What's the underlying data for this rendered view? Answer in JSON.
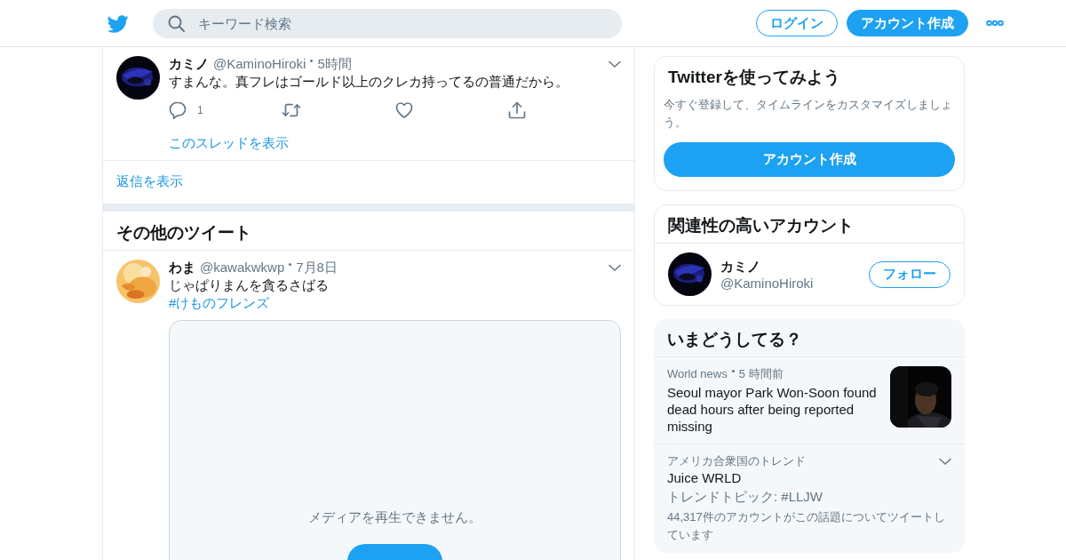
{
  "header": {
    "search": {
      "placeholder": "キーワード検索"
    },
    "login_button": "ログイン",
    "signup_button": "アカウント作成"
  },
  "thread": {
    "tweet": {
      "name": "カミノ",
      "handle": "@KaminoHiroki",
      "time": "5時間",
      "text": "すまんな。真フレはゴールド以上のクレカ持ってるの普通だから。",
      "reply_count": "1"
    },
    "show_thread": "このスレッドを表示",
    "show_replies": "返信を表示"
  },
  "more_tweets": {
    "title": "その他のツイート",
    "tweets": [
      {
        "name": "わま",
        "handle": "@kawakwkwp",
        "time": "7月8日",
        "text": "じゃぱりまんを貪るさばる",
        "hashtag": "#けものフレンズ",
        "media": {
          "message": "メディアを再生できません。"
        }
      }
    ]
  },
  "signup_card": {
    "title": "Twitterを使ってみよう",
    "text": "今すぐ登録して、タイムラインをカスタマイズしましょう。",
    "button": "アカウント作成"
  },
  "related": {
    "title": "関連性の高いアカウント",
    "accounts": [
      {
        "name": "カミノ",
        "handle": "@KaminoHiroki",
        "button": "フォロー"
      }
    ]
  },
  "trends": {
    "title": "いまどうしてる？",
    "items": [
      {
        "kind": "news",
        "meta": "World news",
        "time": "5 時間前",
        "headline": "Seoul mayor Park Won-Soon found dead hours after being reported missing"
      },
      {
        "kind": "trend",
        "meta": "アメリカ合衆国のトレンド",
        "name": "Juice WRLD",
        "topic": "トレンドトピック: #LLJW",
        "count": "44,317件のアカウントがこの話題についてツイートしています"
      }
    ]
  }
}
